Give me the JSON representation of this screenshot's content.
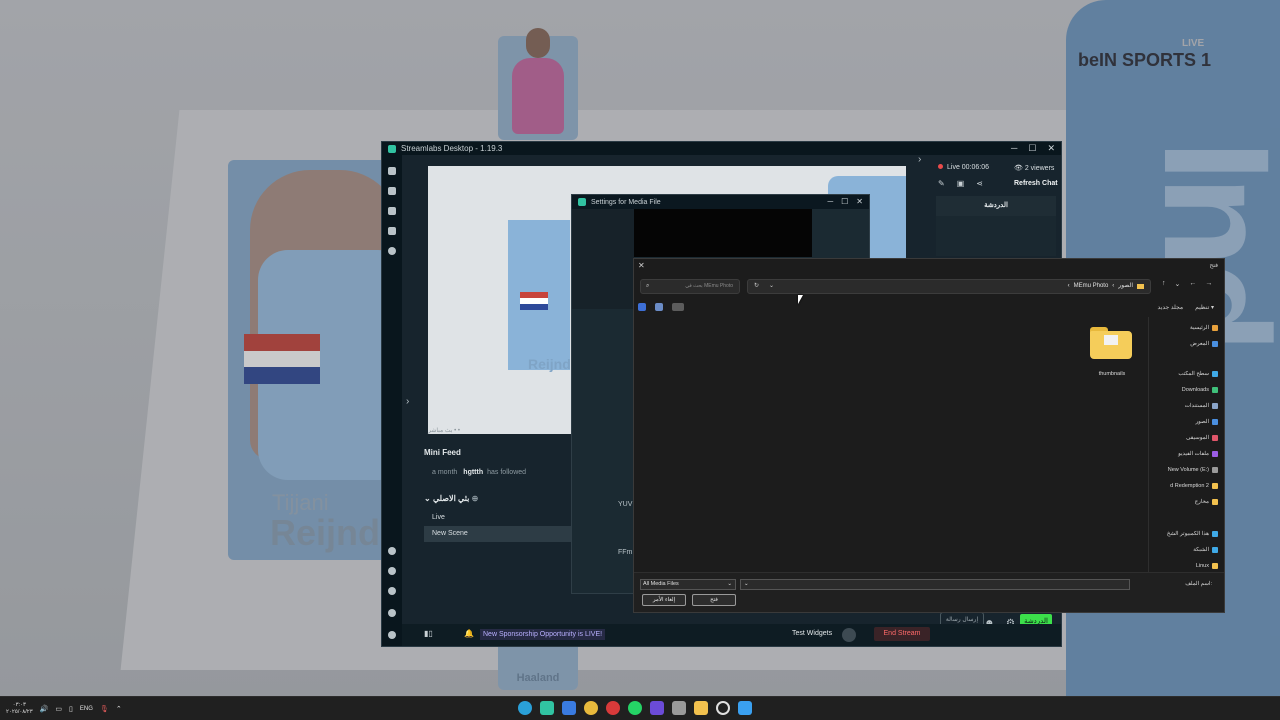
{
  "background": {
    "player_first_name": "Tijjani",
    "player_last_name": "Reijnd",
    "bottom_card_name": "Haaland",
    "broadcaster_logo": "beIN SPORTS 1",
    "broadcaster_tag": "LIVE",
    "right_vertical_text": "Ind"
  },
  "streamlabs": {
    "title": "Streamlabs Desktop - 1.19.3",
    "live_status": "Live 00:06:06",
    "viewers": "2 viewers",
    "refresh_chat": "Refresh Chat",
    "chat_tab": "الدردشة",
    "mini_feed_title": "Mini Feed",
    "feed_time": "a month",
    "feed_user": "hgttth",
    "feed_action": "has followed",
    "scene_collection": "بثي الاصلي",
    "scenes": [
      "Live",
      "New Scene"
    ],
    "sponsor_text": "New Sponsorship Opportunity is LIVE!",
    "test_widgets": "Test Widgets",
    "end_stream": "End Stream",
    "chat_input_placeholder": "إرسال رسالة",
    "chat_send": "الدردشة",
    "preview_footer": "بث مباشر • •"
  },
  "media_settings": {
    "title": "Settings for Media File",
    "label_yuv": "YUV",
    "label_ffm": "FFm"
  },
  "file_dialog": {
    "title": "فتح",
    "search_placeholder": "بحث في MEmu Photo",
    "breadcrumbs": [
      "الصور",
      "MEmu Photo"
    ],
    "organize": "تنظيم",
    "new_folder": "مجلد جديد",
    "nav_items": [
      {
        "label": "الرئيسية",
        "color": "#e8a13c"
      },
      {
        "label": "المعرض",
        "color": "#4a8fe0"
      },
      {
        "label": "سطح المكتب",
        "color": "#3fa9e6"
      },
      {
        "label": "Downloads",
        "color": "#3fc07a"
      },
      {
        "label": "المستندات",
        "color": "#8aa4c8"
      },
      {
        "label": "الصور",
        "color": "#4a8fe0"
      },
      {
        "label": "الموسيقى",
        "color": "#e0566a"
      },
      {
        "label": "ملفات الفيديو",
        "color": "#9b5de5"
      },
      {
        "label": "New Volume (E:)",
        "color": "#9a9a9a"
      },
      {
        "label": "d Redemption 2",
        "color": "#f2c14e"
      },
      {
        "label": "مخارج",
        "color": "#f2c14e"
      },
      {
        "label": "هذا الكمبيوتر الشخ",
        "color": "#3fa9e6"
      },
      {
        "label": "الشبكة",
        "color": "#3fa9e6"
      },
      {
        "label": "Linux",
        "color": "#f2c14e"
      }
    ],
    "folder_name": "thumbnails",
    "filter_value": "All Media Files",
    "filename_label": "اسم الملف:",
    "filename_value": "",
    "open_button": "فتح",
    "cancel_button": "إلغاء الأمر"
  },
  "taskbar": {
    "time": "٠٣:٠٣",
    "date": "٢٠٢٥/٠٨/٢٣",
    "language": "ENG"
  }
}
